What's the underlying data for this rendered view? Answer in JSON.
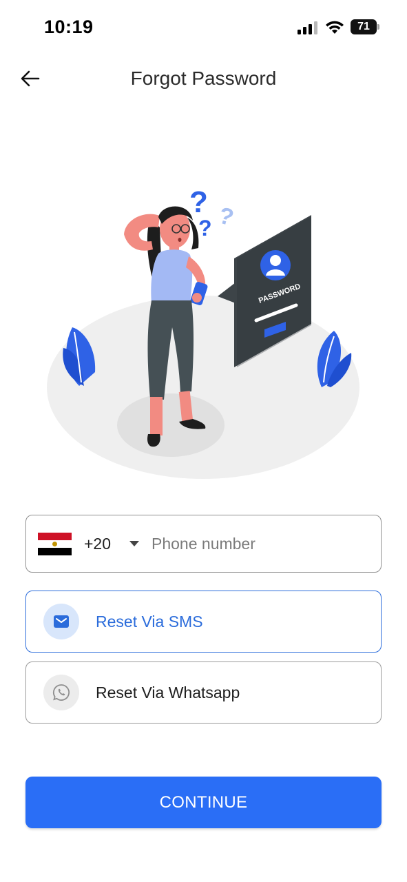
{
  "status_bar": {
    "time": "10:19",
    "battery_level": "71",
    "icons": [
      "cellular-signal-icon",
      "wifi-icon",
      "battery-icon"
    ]
  },
  "header": {
    "title": "Forgot Password",
    "back_icon": "arrow-left-icon"
  },
  "illustration": {
    "screen_label": "PASSWORD"
  },
  "phone": {
    "country_flag": "egypt-flag-icon",
    "country_code": "+20",
    "placeholder": "Phone number",
    "value": ""
  },
  "options": {
    "sms": {
      "label": "Reset Via SMS",
      "icon": "envelope-icon",
      "selected": true
    },
    "whatsapp": {
      "label": "Reset Via Whatsapp",
      "icon": "whatsapp-icon",
      "selected": false
    }
  },
  "actions": {
    "continue_label": "CONTINUE"
  },
  "colors": {
    "primary": "#2a6ef6",
    "selected_border": "#2b6cdb",
    "selected_icon_bg": "#d8e6fb",
    "flag_red": "#ce1126",
    "flag_white": "#ffffff",
    "flag_black": "#000000"
  }
}
